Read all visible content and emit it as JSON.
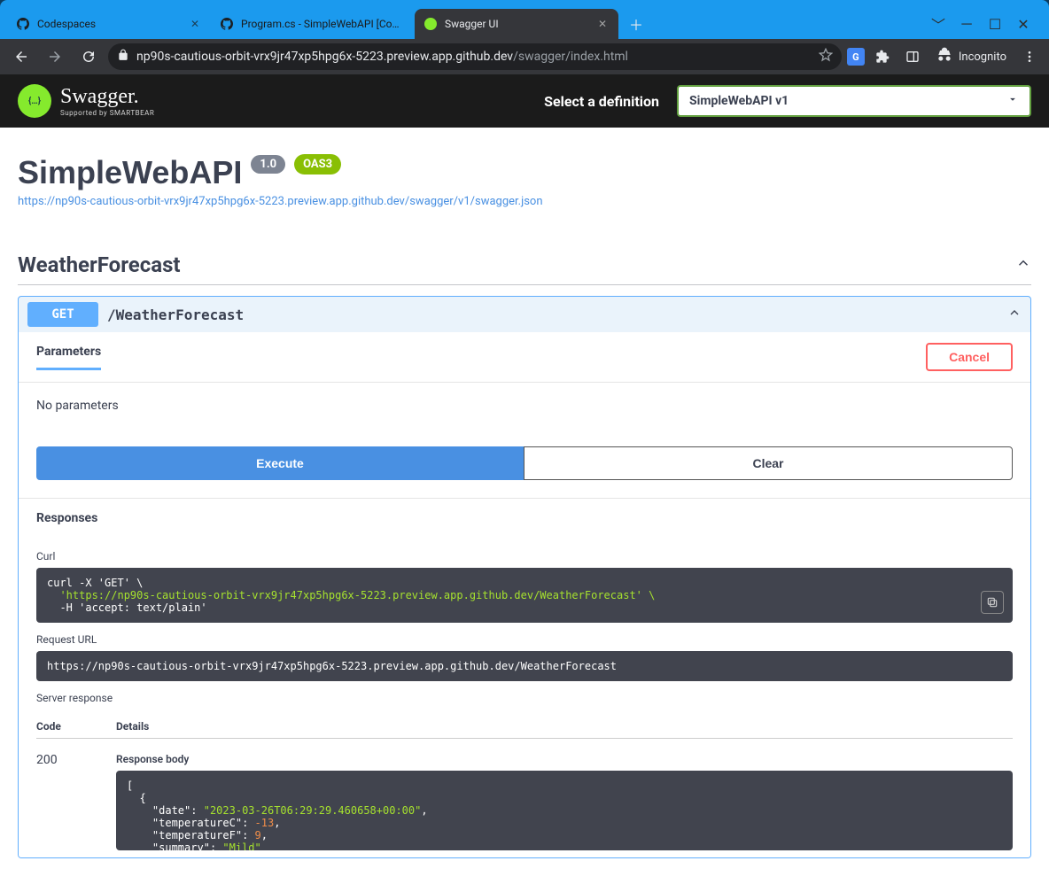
{
  "browser": {
    "tabs": [
      {
        "title": "Codespaces",
        "favicon": "github"
      },
      {
        "title": "Program.cs - SimpleWebAPI [Co…",
        "favicon": "github"
      },
      {
        "title": "Swagger UI",
        "favicon": "swagger",
        "active": true
      }
    ],
    "url_host": "np90s-cautious-orbit-vrx9jr47xp5hpg6x-5223.preview.app.github.dev",
    "url_path": "/swagger/index.html",
    "incognito_label": "Incognito"
  },
  "topbar": {
    "brand": "Swagger.",
    "brand_sub": "Supported by SMARTBEAR",
    "select_label": "Select a definition",
    "selected_definition": "SimpleWebAPI v1"
  },
  "api": {
    "title": "SimpleWebAPI",
    "version": "1.0",
    "oas_badge": "OAS3",
    "spec_url": "https://np90s-cautious-orbit-vrx9jr47xp5hpg6x-5223.preview.app.github.dev/swagger/v1/swagger.json"
  },
  "tag": {
    "name": "WeatherForecast"
  },
  "operation": {
    "method": "GET",
    "path": "/WeatherForecast",
    "parameters_tab": "Parameters",
    "cancel_label": "Cancel",
    "no_params": "No parameters",
    "execute_label": "Execute",
    "clear_label": "Clear",
    "responses_label": "Responses"
  },
  "curl": {
    "label": "Curl",
    "line1": "curl -X 'GET' \\",
    "line2": "  'https://np90s-cautious-orbit-vrx9jr47xp5hpg6x-5223.preview.app.github.dev/WeatherForecast' \\",
    "line3": "  -H 'accept: text/plain'"
  },
  "request_url": {
    "label": "Request URL",
    "value": "https://np90s-cautious-orbit-vrx9jr47xp5hpg6x-5223.preview.app.github.dev/WeatherForecast"
  },
  "server_response": {
    "label": "Server response",
    "code_header": "Code",
    "details_header": "Details",
    "code": "200",
    "body_label": "Response body",
    "json_lines": [
      "[",
      "  {",
      "    \"date\": \"2023-03-26T06:29:29.460658+00:00\",",
      "    \"temperatureC\": -13,",
      "    \"temperatureF\": 9,",
      "    \"summary\": \"Mild\""
    ]
  }
}
